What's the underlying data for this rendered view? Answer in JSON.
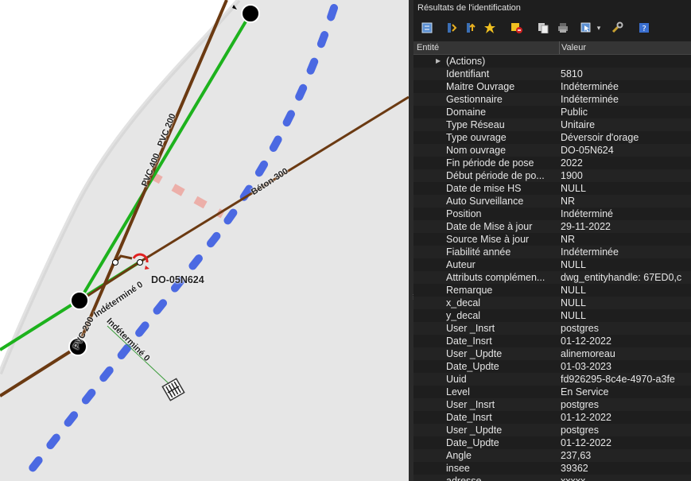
{
  "panel": {
    "title": "Résultats de l'identification",
    "columns": {
      "entity": "Entité",
      "value": "Valeur"
    },
    "actions_label": "(Actions)",
    "rows": [
      {
        "k": "Identifiant",
        "v": "5810"
      },
      {
        "k": "Maitre Ouvrage",
        "v": "Indéterminée"
      },
      {
        "k": "Gestionnaire",
        "v": "Indéterminée"
      },
      {
        "k": "Domaine",
        "v": "Public"
      },
      {
        "k": "Type Réseau",
        "v": "Unitaire"
      },
      {
        "k": "Type ouvrage",
        "v": "Déversoir d'orage"
      },
      {
        "k": "Nom ouvrage",
        "v": "DO-05N624"
      },
      {
        "k": "Fin période de pose",
        "v": "2022"
      },
      {
        "k": "Début période de po...",
        "v": "1900"
      },
      {
        "k": "Date de mise HS",
        "v": "NULL"
      },
      {
        "k": "Auto Surveillance",
        "v": "NR"
      },
      {
        "k": "Position",
        "v": "Indéterminé"
      },
      {
        "k": "Date de Mise à jour",
        "v": "29-11-2022"
      },
      {
        "k": "Source Mise à jour",
        "v": "NR"
      },
      {
        "k": "Fiabilité année",
        "v": "Indéterminée"
      },
      {
        "k": "Auteur",
        "v": "NULL"
      },
      {
        "k": "Attributs complémen...",
        "v": "dwg_entityhandle: 67ED0,c"
      },
      {
        "k": "Remarque",
        "v": "NULL"
      },
      {
        "k": "x_decal",
        "v": "NULL"
      },
      {
        "k": "y_decal",
        "v": "NULL"
      },
      {
        "k": "User _Insrt",
        "v": "postgres"
      },
      {
        "k": "Date_Insrt",
        "v": "01-12-2022"
      },
      {
        "k": "User _Updte",
        "v": "alinemoreau"
      },
      {
        "k": "Date_Updte",
        "v": "01-03-2023"
      },
      {
        "k": "Uuid",
        "v": "fd926295-8c4e-4970-a3fe"
      },
      {
        "k": "Level",
        "v": "En Service"
      },
      {
        "k": "User _Insrt",
        "v": "postgres"
      },
      {
        "k": "Date_Insrt",
        "v": "01-12-2022"
      },
      {
        "k": "User _Updte",
        "v": "postgres"
      },
      {
        "k": "Date_Updte",
        "v": "01-12-2022"
      },
      {
        "k": "Angle",
        "v": "237,63"
      },
      {
        "k": "insee",
        "v": "39362"
      },
      {
        "k": "adresse",
        "v": "xxxxx"
      }
    ],
    "toolbar_icons": [
      "expand-tree-icon",
      "collapse-tree-icon",
      "expand-new-icon",
      "highlight-icon",
      "clear-results-icon",
      "copy-icon",
      "print-icon",
      "identify-mode-icon",
      "settings-icon",
      "help-icon"
    ]
  },
  "map": {
    "labels": {
      "pvc400": "PVC 400",
      "pvc200_top": "PVC 200",
      "beton300": "Béton 300",
      "indetermine0_a": "Indéterminé 0",
      "do_name": "DO-05N624",
      "pvc200_bottom": "PVC 200",
      "indetermine0_b": "Indéterminé 0"
    }
  }
}
